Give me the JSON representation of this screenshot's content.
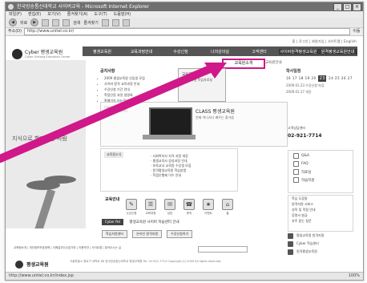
{
  "browser": {
    "title_bar": "한국방송통신대학교 사이버교육 - Microsoft Internet Explorer",
    "window_buttons": [
      "_",
      "□",
      "×"
    ],
    "menu": [
      "파일(F)",
      "편집(E)",
      "보기(V)",
      "즐겨찾기(A)",
      "도구(T)",
      "도움말(H)"
    ],
    "toolbar": {
      "back_label": "뒤로",
      "forward_label": "◀▶",
      "search_label": "검색",
      "favorites_label": "즐겨찾기"
    },
    "address_label": "주소(D)",
    "url": "http://www.unitel.co.kr/",
    "go_label": "이동",
    "status_text": "http://www.unitel.co.kr/index.jsp",
    "status_zoom": "100%"
  },
  "site": {
    "top_links": "홈 | 로그인 | 회원가입 | 사이트맵 | English",
    "logo_name": "Cyber 평생교육원",
    "logo_sub": "Cyber Lifelong Education Center",
    "gnb": [
      "평생교육원",
      "교육과정안내",
      "수강신청",
      "나의강의실",
      "고객센터",
      "사이버원격평생교육원",
      "원격평생교육원안내"
    ],
    "submenu_selected": "교육원소개",
    "submenu_next": "교육원안내",
    "handwriting": "지식으로 함께하는 사람",
    "notice": {
      "title": "공지사항",
      "items": [
        "2009 평생교육원 신입생 모집",
        "사이버 원격 교육과정 안내",
        "수강신청 기간 안내",
        "학점인정 과정 설명회",
        "홈페이지 리뉴얼 안내"
      ]
    },
    "banner": {
      "text": "교육과정 안내",
      "small": "평생교육원 학습자료실"
    },
    "calendar": {
      "title": "학사일정",
      "days": [
        "16",
        "17",
        "18",
        "19",
        "20"
      ],
      "today": "23",
      "after": [
        "24",
        "25",
        "26",
        "27"
      ],
      "events": [
        "2009.01.23 수강신청 마감",
        "2009.01.27 개강"
      ]
    },
    "laptop_area": {
      "label": "교육과정 안내",
      "slogan": "CLASS 평생교육원",
      "sub": "언제 어디서나 배우는 즐거움"
    },
    "phone": {
      "label": "고객상담센터",
      "number": "02-921-7714"
    },
    "mid_list": {
      "label": "교육원소식",
      "items": [
        "· 사회복지사 자격 과정 개강",
        "· 평생교육사 양성과정 안내",
        "· 보육교사 교육원 수강생 모집",
        "· 원격평생교육원 학습방법",
        "· 학점은행제 이수 안내"
      ]
    },
    "checklist": [
      "Q&A",
      "FAQ",
      "자료실",
      "학습지원"
    ],
    "icon_label": "교육안내",
    "icons": [
      {
        "glyph": "✎",
        "label": "수강신청"
      },
      {
        "glyph": "☰",
        "label": "교육과정"
      },
      {
        "glyph": "✉",
        "label": "상담"
      },
      {
        "glyph": "☎",
        "label": "문의"
      },
      {
        "glyph": "★",
        "label": "이벤트"
      },
      {
        "glyph": "⌂",
        "label": "홈"
      }
    ],
    "faq": [
      "학습 도움말",
      "원격지원 서비스",
      "성적 및 학점 안내",
      "증명서 발급",
      "자주 묻는 질문"
    ],
    "cyber_badge": "Cyber Pol",
    "cyber_strip": "평생교육원 사이버 학습센터 안내",
    "buttons": [
      "학습지원센터",
      "온라인 원격지원",
      "수강신청하기"
    ],
    "right_icons": [
      "평생교육원 원격지원",
      "Cyber 학습센터",
      "원격평생교육원"
    ],
    "footer_links": "교육원소개 | 개인정보보호정책 | 이메일무단수집거부 | 이용약관 | 사이트맵 | 찾아오시는 길",
    "footer_name": "평생교육원",
    "footer_text": "서울특별시 종로구 대학로 86 한국방송통신대학교 평생교육원 Tel. 02-921-7714 Copyright (c) 2009 All rights reserved."
  }
}
